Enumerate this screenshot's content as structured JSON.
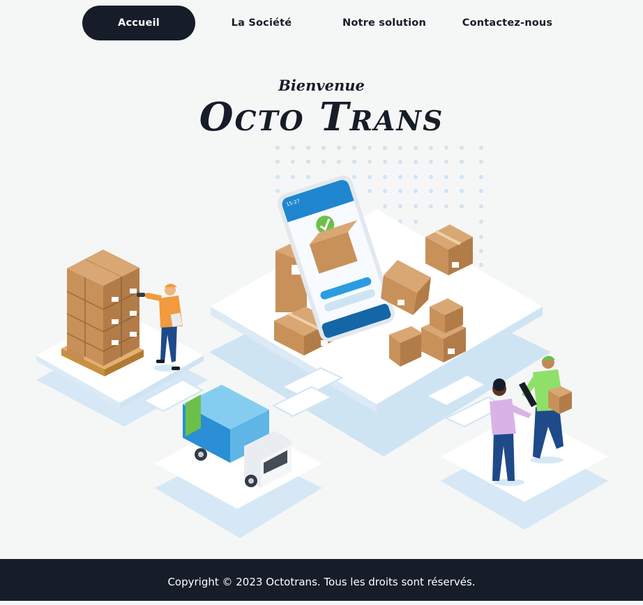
{
  "nav": {
    "items": [
      {
        "label": "Accueil",
        "active": true
      },
      {
        "label": "La Société",
        "active": false
      },
      {
        "label": "Notre solution",
        "active": false
      },
      {
        "label": "Contactez-nous",
        "active": false
      }
    ]
  },
  "hero": {
    "subtitle": "Bienvenue",
    "title": "Octo Trans"
  },
  "phone": {
    "time": "15:27"
  },
  "footer": {
    "copyright": "Copyright © 2023 Octotrans. Tous les droits sont réservés."
  },
  "colors": {
    "dark": "#161d29",
    "background": "#f5f7f6",
    "accent_blue": "#2a8fd4",
    "box": "#c8915a",
    "check_green": "#6cc04a"
  }
}
